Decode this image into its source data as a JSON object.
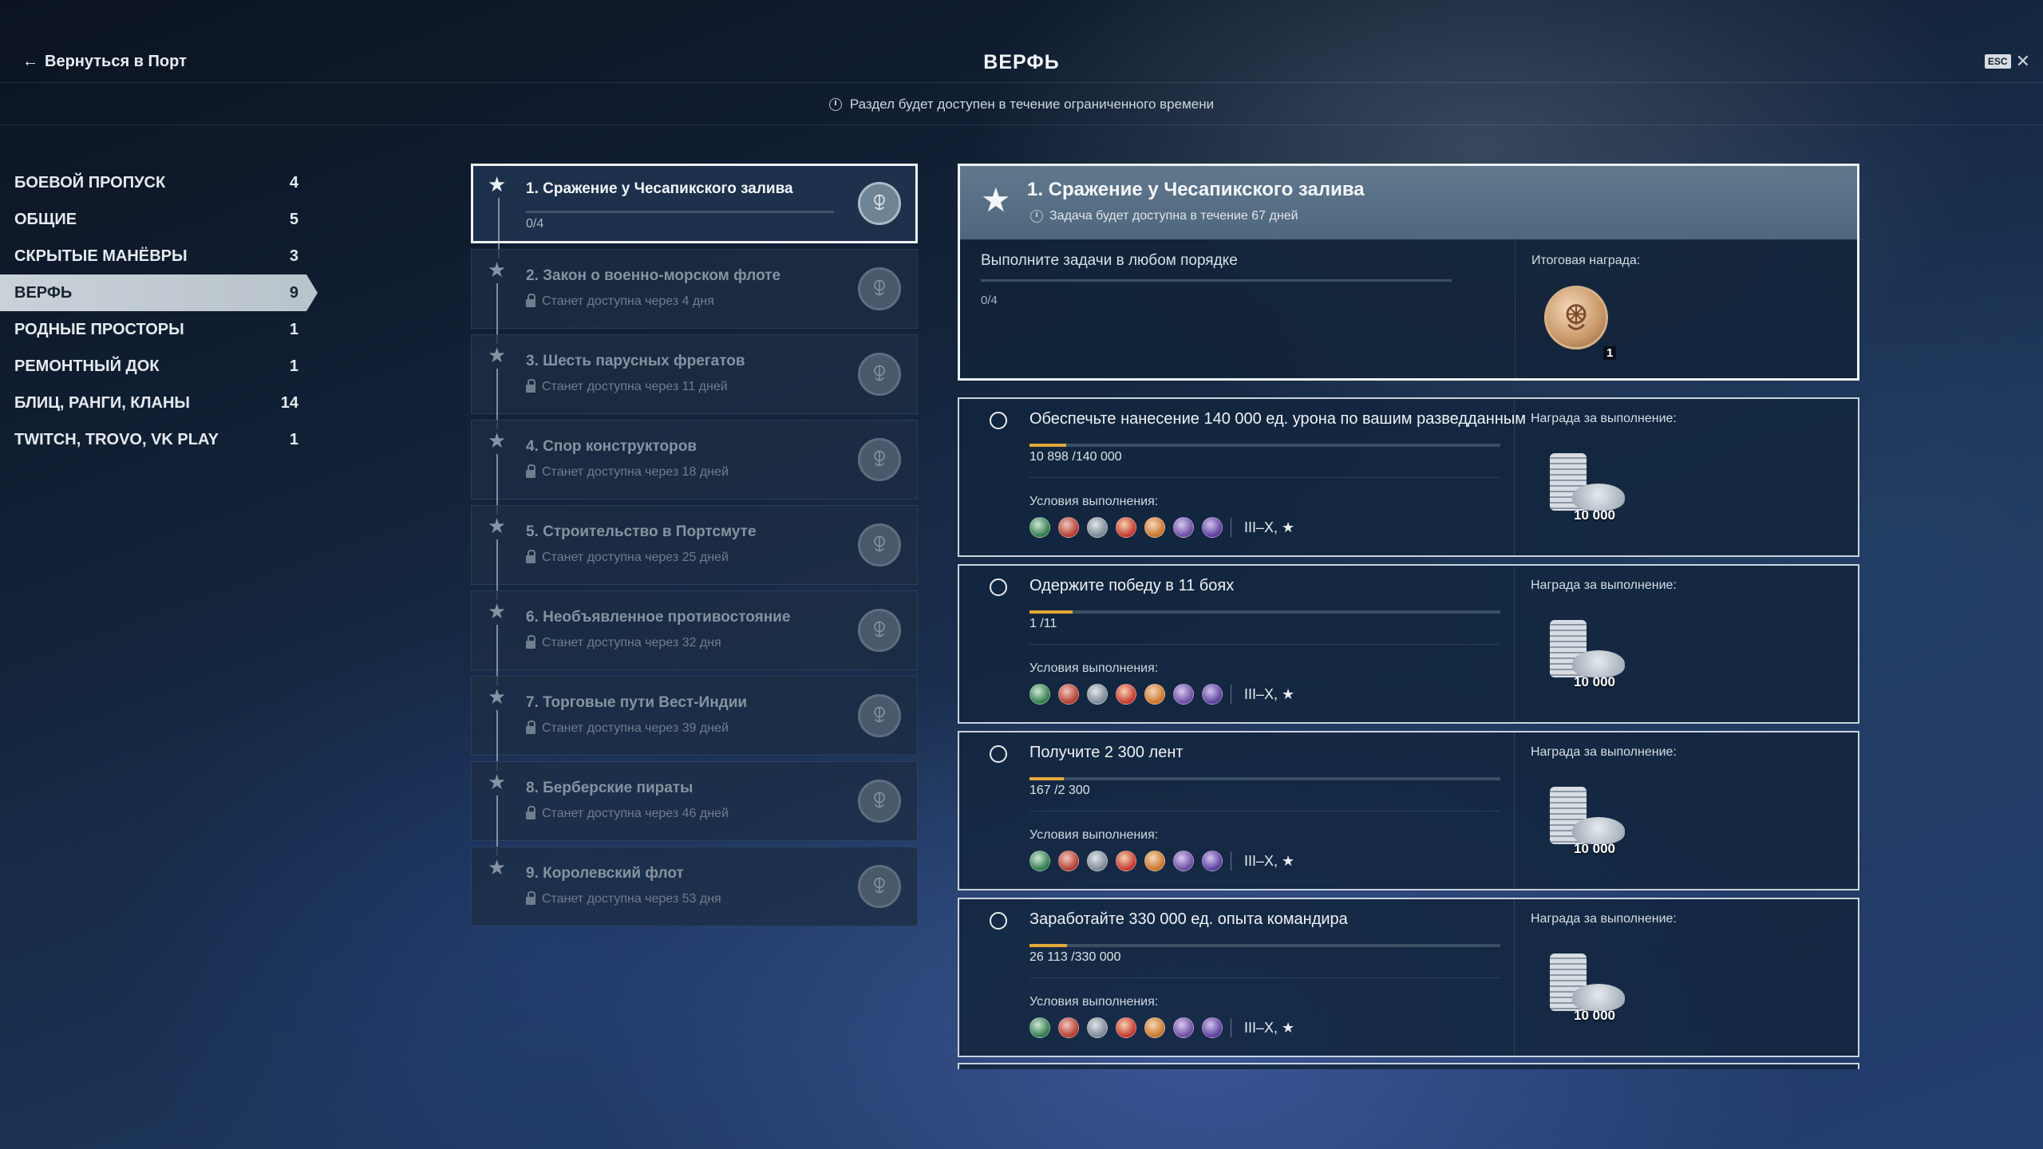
{
  "header": {
    "back_label": "Вернуться в Порт",
    "title": "ВЕРФЬ",
    "esc_label": "ESC",
    "close_glyph": "✕",
    "notice": "Раздел будет доступен в течение ограниченного времени"
  },
  "sidebar": {
    "items": [
      {
        "label": "БОЕВОЙ ПРОПУСК",
        "count": "4"
      },
      {
        "label": "ОБЩИЕ",
        "count": "5"
      },
      {
        "label": "СКРЫТЫЕ МАНЁВРЫ",
        "count": "3"
      },
      {
        "label": "ВЕРФЬ",
        "count": "9"
      },
      {
        "label": "РОДНЫЕ ПРОСТОРЫ",
        "count": "1"
      },
      {
        "label": "РЕМОНТНЫЙ ДОК",
        "count": "1"
      },
      {
        "label": "БЛИЦ, РАНГИ, КЛАНЫ",
        "count": "14"
      },
      {
        "label": "TWITCH, TROVO, VK PLAY",
        "count": "1"
      }
    ]
  },
  "quests": [
    {
      "name": "1. Сражение у Чесапикского залива",
      "sub": "0/4",
      "locked": false
    },
    {
      "name": "2. Закон о военно-морском флоте",
      "sub": "Станет доступна через 4 дня",
      "locked": true
    },
    {
      "name": "3. Шесть парусных фрегатов",
      "sub": "Станет доступна через 11 дней",
      "locked": true
    },
    {
      "name": "4. Спор конструкторов",
      "sub": "Станет доступна через 18 дней",
      "locked": true
    },
    {
      "name": "5. Строительство в Портсмуте",
      "sub": "Станет доступна через 25 дней",
      "locked": true
    },
    {
      "name": "6. Необъявленное противостояние",
      "sub": "Станет доступна через 32 дня",
      "locked": true
    },
    {
      "name": "7. Торговые пути Вест-Индии",
      "sub": "Станет доступна через 39 дней",
      "locked": true
    },
    {
      "name": "8. Берберские пираты",
      "sub": "Станет доступна через 46 дней",
      "locked": true
    },
    {
      "name": "9. Королевский флот",
      "sub": "Станет доступна через 53 дня",
      "locked": true
    }
  ],
  "detail": {
    "title": "1. Сражение у Чесапикского залива",
    "availability": "Задача будет доступна в течение 67 дней",
    "instruction": "Выполните задачи в любом порядке",
    "progress": "0/4",
    "final_reward_label": "Итоговая награда:",
    "final_reward_count": "1"
  },
  "tasks": [
    {
      "text": "Обеспечьте нанесение 140 000 ед. урона по вашим разведданным",
      "progress": "10 898 /140 000",
      "fraction": 0.078,
      "conditions_label": "Условия выполнения:",
      "tiers": "III–X, ★",
      "reward_label": "Награда за выполнение:",
      "reward": "10 000"
    },
    {
      "text": "Одержите победу в 11 боях",
      "progress": "1 /11",
      "fraction": 0.091,
      "conditions_label": "Условия выполнения:",
      "tiers": "III–X, ★",
      "reward_label": "Награда за выполнение:",
      "reward": "10 000"
    },
    {
      "text": "Получите 2 300 лент",
      "progress": "167 /2 300",
      "fraction": 0.073,
      "conditions_label": "Условия выполнения:",
      "tiers": "III–X, ★",
      "reward_label": "Награда за выполнение:",
      "reward": "10 000"
    },
    {
      "text": "Заработайте 330 000 ед. опыта командира",
      "progress": "26 113 /330 000",
      "fraction": 0.079,
      "conditions_label": "Условия выполнения:",
      "tiers": "III–X, ★",
      "reward_label": "Награда за выполнение:",
      "reward": "10 000"
    }
  ],
  "colors": {
    "progress_fill": "#e3a938",
    "active_tab_bg": "#c9d2d9",
    "panel_border": "#eef2f5"
  },
  "condition_icons": [
    "nation-green-icon",
    "nation-red-icon",
    "nation-gray-icon",
    "nation-red-star-icon",
    "nation-orange-icon",
    "nation-purple-icon",
    "nation-violet-icon"
  ]
}
